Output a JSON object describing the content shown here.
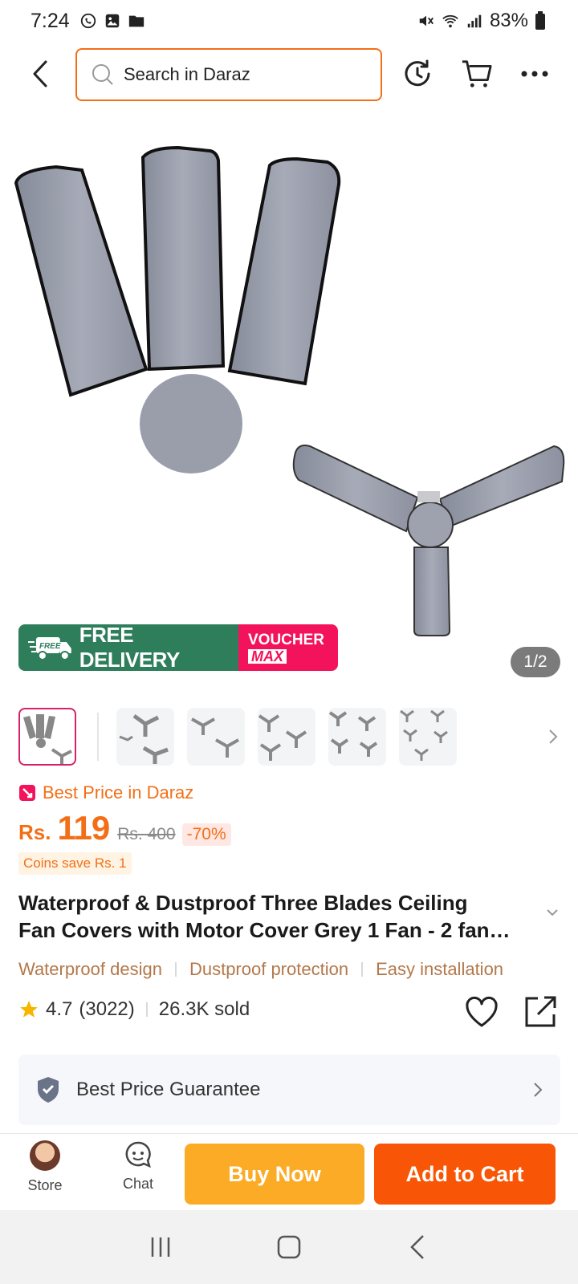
{
  "status_bar": {
    "time": "7:24",
    "battery": "83%"
  },
  "search": {
    "placeholder": "Search in Daraz"
  },
  "gallery": {
    "free_delivery_badge": "FREE",
    "free_delivery": "FREE DELIVERY",
    "voucher_line1": "VOUCHER",
    "voucher_line2": "MAX",
    "page_indicator": "1/2"
  },
  "price": {
    "best_price_label": "Best Price in Daraz",
    "currency": "Rs.",
    "current": "119",
    "original": "Rs. 400",
    "discount": "-70%",
    "coins": "Coins save Rs. 1"
  },
  "product": {
    "title_line1": "Waterproof & Dustproof Three Blades Ceiling",
    "title_line2": "Fan Covers with Motor Cover Grey 1 Fan - 2 fan…",
    "features": [
      "Waterproof design",
      "Dustproof protection",
      "Easy installation"
    ],
    "rating": "4.7",
    "reviews": "(3022)",
    "sold": "26.3K sold"
  },
  "guarantee": {
    "label": "Best Price Guarantee"
  },
  "action_bar": {
    "store_label": "Store",
    "chat_label": "Chat",
    "buy_now": "Buy Now",
    "add_to_cart": "Add to Cart"
  },
  "colors": {
    "accent": "#f36f17",
    "buy_now": "#fbab25",
    "add_to_cart": "#f85606",
    "delivery_green": "#2e7d5b",
    "voucher_pink": "#f3135d",
    "feature_text": "#b3784a"
  }
}
